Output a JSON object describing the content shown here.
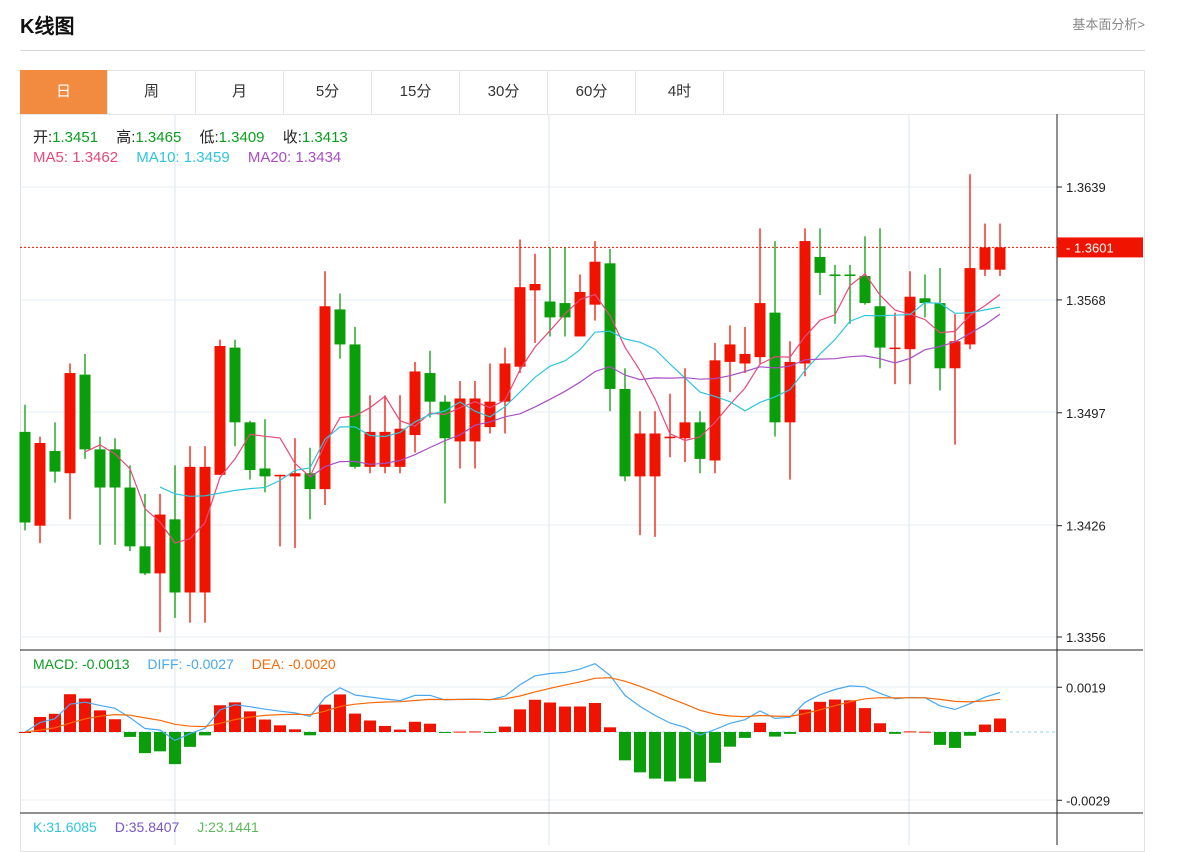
{
  "header": {
    "title": "K线图",
    "link": "基本面分析>"
  },
  "tabs": [
    {
      "label": "日",
      "active": true
    },
    {
      "label": "周"
    },
    {
      "label": "月"
    },
    {
      "label": "5分"
    },
    {
      "label": "15分"
    },
    {
      "label": "30分"
    },
    {
      "label": "60分"
    },
    {
      "label": "4时"
    }
  ],
  "ohlc": {
    "open_label": "开:",
    "open": "1.3451",
    "high_label": "高:",
    "high": "1.3465",
    "low_label": "低:",
    "low": "1.3409",
    "close_label": "收:",
    "close": "1.3413"
  },
  "ma": {
    "ma5_label": "MA5:",
    "ma5": "1.3462",
    "ma10_label": "MA10:",
    "ma10": "1.3459",
    "ma20_label": "MA20:",
    "ma20": "1.3434"
  },
  "macd": {
    "macd_label": "MACD:",
    "macd": "-0.0013",
    "diff_label": "DIFF:",
    "diff": "-0.0027",
    "dea_label": "DEA:",
    "dea": "-0.0020"
  },
  "kdj": {
    "k_label": "K:",
    "k": "31.6085",
    "d_label": "D:",
    "d": "35.8407",
    "j_label": "J:",
    "j": "23.1441"
  },
  "colors": {
    "up": "#f01400",
    "down": "#0a9e0a",
    "ma5": "#e8487a",
    "ma10": "#2ec5dc",
    "ma20": "#a84fc4",
    "diff": "#4aa8f0",
    "dea": "#f56a0a",
    "accent": "#f28b3f"
  },
  "chart_data": {
    "type": "candlestick",
    "price_ticks": [
      "1.3639",
      "1.3568",
      "1.3497",
      "1.3426",
      "1.3356"
    ],
    "price_range": [
      1.3356,
      1.3639
    ],
    "current_price": "1.3601",
    "macd_ticks": [
      "0.0019",
      "-0.0029"
    ],
    "macd_range": [
      -0.0029,
      0.0019
    ],
    "candles": [
      [
        1.3485,
        1.3428,
        1.3502,
        1.3423
      ],
      [
        1.3426,
        1.3478,
        1.3482,
        1.3415
      ],
      [
        1.3473,
        1.346,
        1.3491,
        1.3453
      ],
      [
        1.3459,
        1.3522,
        1.3528,
        1.343
      ],
      [
        1.3521,
        1.3474,
        1.3534,
        1.3468
      ],
      [
        1.3474,
        1.345,
        1.3482,
        1.3414
      ],
      [
        1.3474,
        1.345,
        1.3481,
        1.3414
      ],
      [
        1.345,
        1.3413,
        1.3464,
        1.341
      ],
      [
        1.3413,
        1.3396,
        1.3446,
        1.3395
      ],
      [
        1.3396,
        1.3433,
        1.3446,
        1.3359
      ],
      [
        1.343,
        1.3384,
        1.3464,
        1.3368
      ],
      [
        1.3384,
        1.3463,
        1.3476,
        1.3365
      ],
      [
        1.3384,
        1.3463,
        1.3476,
        1.3365
      ],
      [
        1.3458,
        1.3539,
        1.3543,
        1.3458
      ],
      [
        1.3538,
        1.3491,
        1.3543,
        1.3476
      ],
      [
        1.3491,
        1.3461,
        1.3492,
        1.3455
      ],
      [
        1.3462,
        1.3457,
        1.3493,
        1.3447
      ],
      [
        1.3457,
        1.3458,
        1.3458,
        1.3413
      ],
      [
        1.3457,
        1.3459,
        1.3481,
        1.3412
      ],
      [
        1.3459,
        1.3449,
        1.3475,
        1.343
      ],
      [
        1.3449,
        1.3564,
        1.3586,
        1.3439
      ],
      [
        1.3562,
        1.354,
        1.3572,
        1.3531
      ],
      [
        1.354,
        1.3463,
        1.3551,
        1.3462
      ],
      [
        1.3463,
        1.3485,
        1.3508,
        1.3459
      ],
      [
        1.3463,
        1.3485,
        1.3508,
        1.3459
      ],
      [
        1.3463,
        1.3487,
        1.3508,
        1.3459
      ],
      [
        1.3483,
        1.3523,
        1.3529,
        1.3472
      ],
      [
        1.3522,
        1.3504,
        1.3536,
        1.3494
      ],
      [
        1.3504,
        1.3481,
        1.3508,
        1.344
      ],
      [
        1.3479,
        1.3506,
        1.3517,
        1.3462
      ],
      [
        1.3479,
        1.3506,
        1.3517,
        1.3462
      ],
      [
        1.3488,
        1.3504,
        1.3528,
        1.3484
      ],
      [
        1.3504,
        1.3528,
        1.3538,
        1.3484
      ],
      [
        1.3526,
        1.3576,
        1.3606,
        1.3522
      ],
      [
        1.3574,
        1.3578,
        1.3597,
        1.3541
      ],
      [
        1.3567,
        1.3557,
        1.3601,
        1.3545
      ],
      [
        1.3566,
        1.3557,
        1.3601,
        1.3545
      ],
      [
        1.3545,
        1.3573,
        1.3584,
        1.3545
      ],
      [
        1.3565,
        1.3592,
        1.3605,
        1.3555
      ],
      [
        1.3591,
        1.3512,
        1.36,
        1.3498
      ],
      [
        1.3512,
        1.3457,
        1.3525,
        1.3454
      ],
      [
        1.3457,
        1.3484,
        1.3498,
        1.342
      ],
      [
        1.3457,
        1.3484,
        1.3498,
        1.3419
      ],
      [
        1.3481,
        1.3482,
        1.3509,
        1.3469
      ],
      [
        1.3481,
        1.3491,
        1.3525,
        1.3466
      ],
      [
        1.3491,
        1.3468,
        1.3498,
        1.3459
      ],
      [
        1.3467,
        1.353,
        1.3541,
        1.3459
      ],
      [
        1.3529,
        1.354,
        1.3552,
        1.351
      ],
      [
        1.3528,
        1.3534,
        1.3551,
        1.3522
      ],
      [
        1.3532,
        1.3566,
        1.3613,
        1.3528
      ],
      [
        1.356,
        1.3491,
        1.3605,
        1.3482
      ],
      [
        1.3491,
        1.3529,
        1.3542,
        1.3455
      ],
      [
        1.3528,
        1.3605,
        1.3613,
        1.352
      ],
      [
        1.3595,
        1.3585,
        1.3613,
        1.3571
      ],
      [
        1.3584,
        1.3583,
        1.359,
        1.3553
      ],
      [
        1.3584,
        1.3583,
        1.359,
        1.3553
      ],
      [
        1.3583,
        1.3566,
        1.3608,
        1.3565
      ],
      [
        1.3564,
        1.3538,
        1.3613,
        1.3525
      ],
      [
        1.3538,
        1.3538,
        1.356,
        1.3515
      ],
      [
        1.3537,
        1.357,
        1.3586,
        1.3515
      ],
      [
        1.3569,
        1.3566,
        1.3584,
        1.3557
      ],
      [
        1.3566,
        1.3525,
        1.3588,
        1.3511
      ],
      [
        1.3525,
        1.3542,
        1.3559,
        1.3477
      ],
      [
        1.354,
        1.3588,
        1.3647,
        1.3537
      ],
      [
        1.3587,
        1.3601,
        1.3616,
        1.3583
      ],
      [
        1.3587,
        1.3601,
        1.3616,
        1.3583
      ]
    ]
  }
}
